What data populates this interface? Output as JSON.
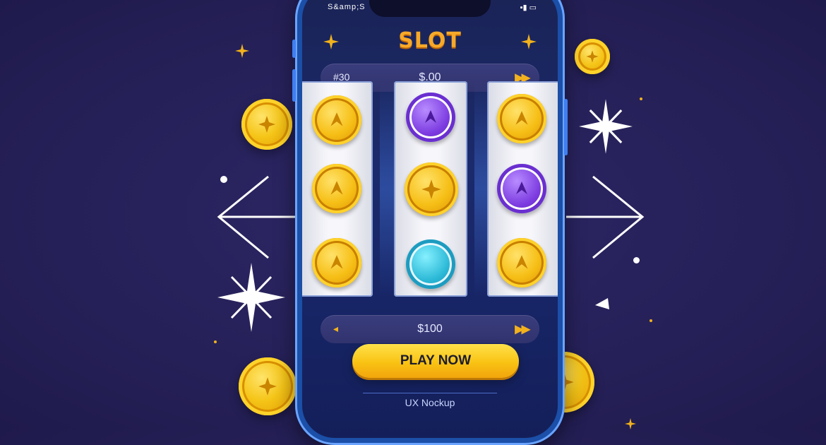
{
  "app": {
    "title": "SLOT",
    "status_left": "S&amp;S",
    "status_right": "▪▮ ▭"
  },
  "bet_bar": {
    "left_value": "#30",
    "center_value": "$.00",
    "next_label": "▶▶"
  },
  "win_bar": {
    "prev_label": "◂",
    "center_value": "$100",
    "next_label": "▶▶"
  },
  "reels": [
    [
      "gold-coin",
      "gold-coin",
      "gold-coin"
    ],
    [
      "purple-chip",
      "gold-coin",
      "teal-chip"
    ],
    [
      "gold-coin",
      "purple-chip",
      "gold-coin"
    ]
  ],
  "play_button": {
    "label": "PLAY NOW"
  },
  "footer": {
    "caption": "UX Nockup"
  },
  "colors": {
    "background": "#27225a",
    "phone_frame": "#1b4fa8",
    "accent_gold": "#f7a928",
    "button_yellow": "#f9c313"
  }
}
